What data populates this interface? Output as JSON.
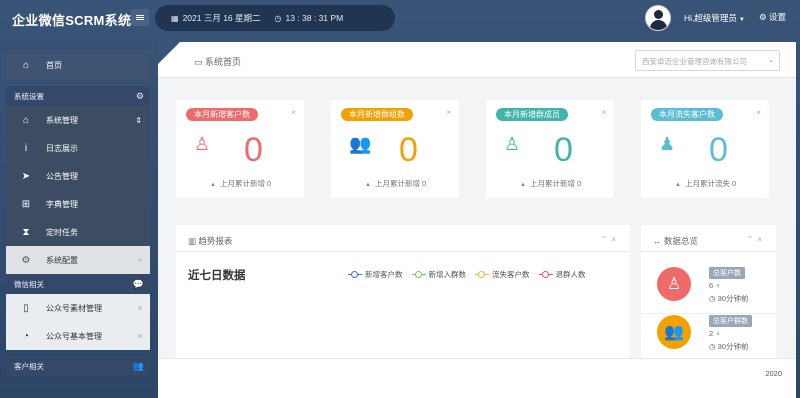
{
  "app": {
    "title": "企业微信SCRM系统"
  },
  "header": {
    "date": "2021 三月 16 星期二",
    "time": "13 : 38 : 31 PM",
    "user": "Hi,超级管理员",
    "settings": "设置"
  },
  "sidebar": {
    "home": "首页",
    "group_system": "系统设置",
    "system_manage": "系统管理",
    "sub_items": [
      "日志展示",
      "公告管理",
      "字典管理",
      "定时任务"
    ],
    "system_config": "系统配置",
    "group_wechat": "微信相关",
    "wechat_items": [
      "公众号素材管理",
      "公众号基本管理"
    ],
    "group_customer": "客户相关"
  },
  "breadcrumb": {
    "label": "系统首页"
  },
  "company_select": {
    "value": "西安卓迈企业管理咨询有限公司"
  },
  "cards": [
    {
      "tag": "本月新增客户数",
      "value": "0",
      "foot": "上月累计新增 0",
      "color": "#ef6b6b"
    },
    {
      "tag": "本月新增群组数",
      "value": "0",
      "foot": "上月累计新增 0",
      "color": "#f2a100"
    },
    {
      "tag": "本月新增群成员",
      "value": "0",
      "foot": "上月累计新增 0",
      "color": "#3fb3ac"
    },
    {
      "tag": "本月流失客户数",
      "value": "0",
      "foot": "上月累计流失 0",
      "color": "#5bbcd6"
    }
  ],
  "trend": {
    "title": "趋势报表",
    "heading": "近七日数据",
    "legend": [
      {
        "label": "新增客户数",
        "color": "#4a6fd6"
      },
      {
        "label": "新增入群数",
        "color": "#7cc35a"
      },
      {
        "label": "流失客户数",
        "color": "#f2b531"
      },
      {
        "label": "退群人数",
        "color": "#e65a5a"
      }
    ]
  },
  "summary": {
    "title": "数据总览",
    "rows": [
      {
        "badge": "总客户数",
        "value": "6",
        "time": "30分钟前",
        "color": "#ef6b6b"
      },
      {
        "badge": "总客户群数",
        "value": "2",
        "time": "30分钟前",
        "color": "#f2a100"
      }
    ]
  },
  "footer": {
    "year": "2020"
  }
}
